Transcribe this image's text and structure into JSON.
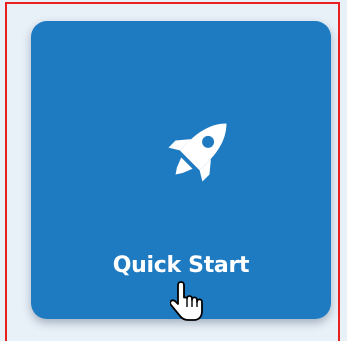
{
  "tile": {
    "label": "Quick Start",
    "icon": "rocket-icon",
    "background": "#1f7bc1",
    "text_color": "#ffffff"
  },
  "frame": {
    "border_color": "#e8201e"
  },
  "page": {
    "background": "#e8f0f8"
  },
  "cursor": {
    "icon": "hand-pointer-icon"
  }
}
